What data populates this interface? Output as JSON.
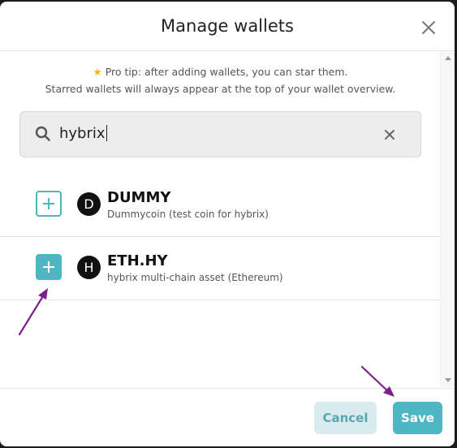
{
  "dialog": {
    "title": "Manage wallets",
    "close_icon": "close-icon"
  },
  "tip": {
    "icon": "star-icon",
    "line1": "Pro tip: after adding wallets, you can star them.",
    "line2": "Starred wallets will always appear at the top of your wallet overview."
  },
  "search": {
    "icon": "search-icon",
    "value": "hybrix",
    "clear_icon": "clear-icon"
  },
  "wallets": [
    {
      "initial": "D",
      "symbol": "DUMMY",
      "description": "Dummycoin (test coin for hybrix)",
      "added": false
    },
    {
      "initial": "H",
      "symbol": "ETH.HY",
      "description": "hybrix multi-chain asset (Ethereum)",
      "added": true
    }
  ],
  "footer": {
    "cancel_label": "Cancel",
    "save_label": "Save"
  },
  "colors": {
    "accent": "#4fb7c4",
    "cancel_bg": "#d8ecef",
    "annotation_arrow": "#7b1f8c",
    "star": "#f0b90b"
  }
}
